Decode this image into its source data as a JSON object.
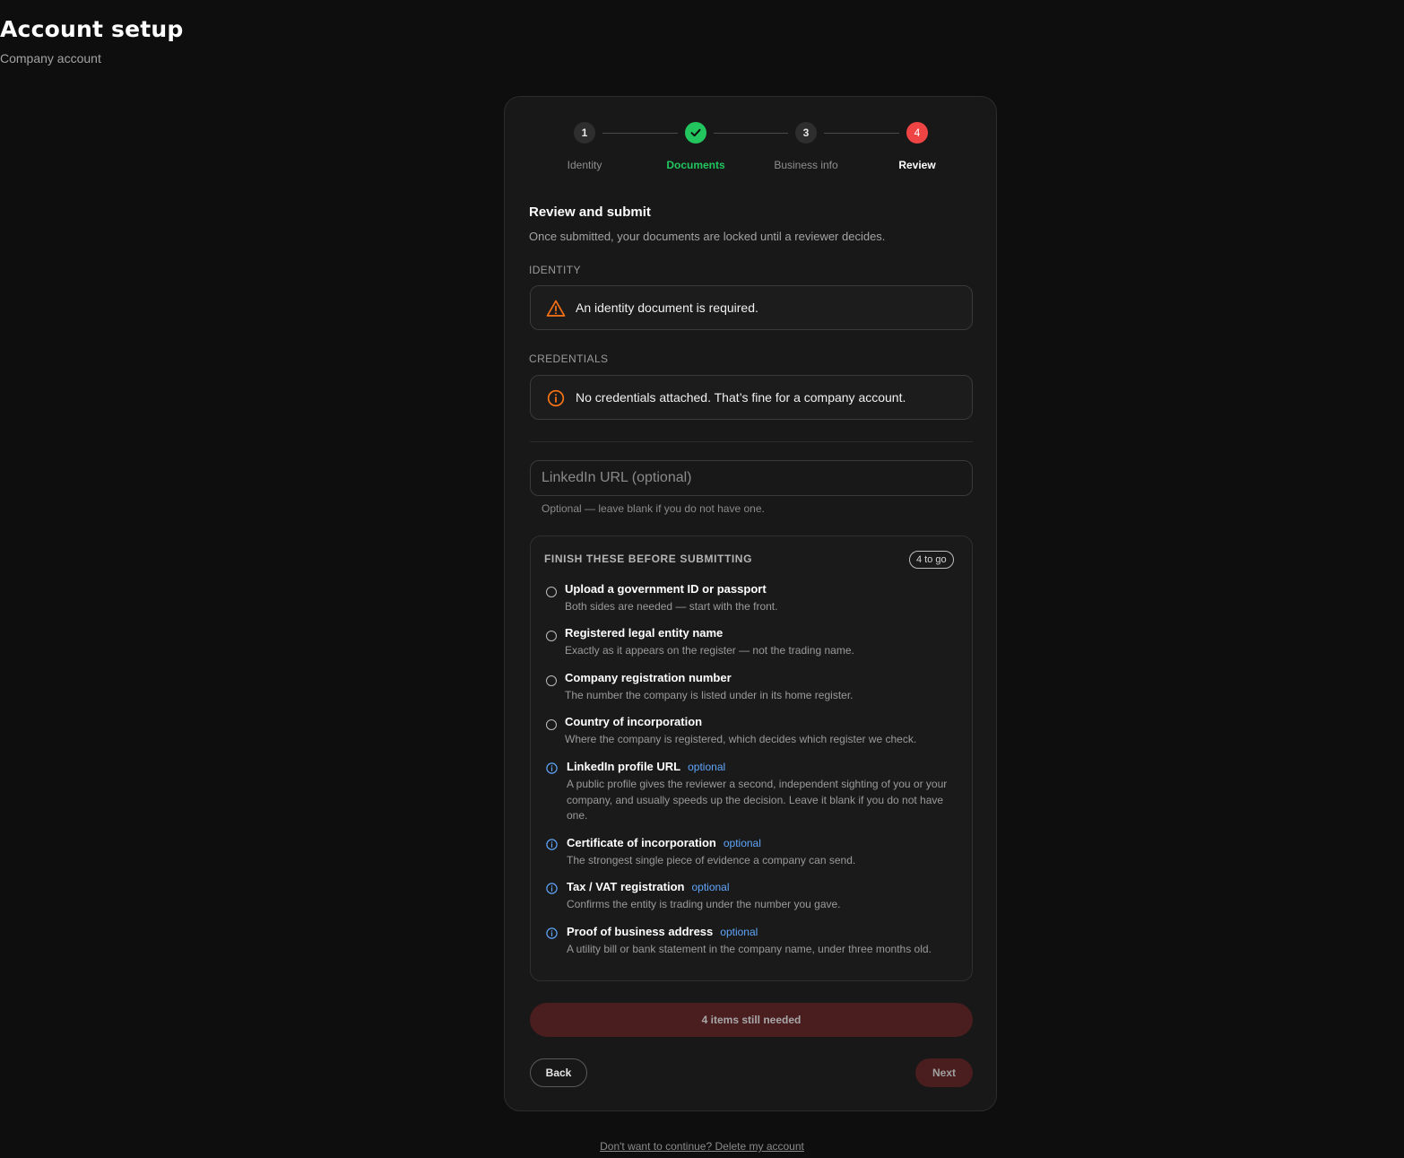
{
  "header": {
    "title": "Account setup",
    "subtitle": "Company account"
  },
  "stepper": {
    "steps": [
      {
        "number": "1",
        "label": "Identity",
        "state": "neutral"
      },
      {
        "number": "",
        "label": "Documents",
        "state": "done",
        "icon": "check-icon"
      },
      {
        "number": "3",
        "label": "Business info",
        "state": "neutral"
      },
      {
        "number": "4",
        "label": "Review",
        "state": "current"
      }
    ]
  },
  "review": {
    "title": "Review and submit",
    "description": "Once submitted, your documents are locked until a reviewer decides."
  },
  "identity": {
    "label": "IDENTITY",
    "notice": "An identity document is required.",
    "icon": "warning-triangle-icon"
  },
  "credentials": {
    "label": "CREDENTIALS",
    "notice": "No credentials attached. That’s fine for a company account.",
    "icon": "info-circle-icon"
  },
  "linkedin_field": {
    "value": "",
    "placeholder": "LinkedIn URL (optional)",
    "help": "Optional — leave blank if you do not have one."
  },
  "checklist": {
    "title": "FINISH THESE BEFORE SUBMITTING",
    "badge": "4 to go",
    "items": [
      {
        "title": "Upload a government ID or passport",
        "description": "Both sides are needed — start with the front.",
        "optional": ""
      },
      {
        "title": "Registered legal entity name",
        "description": "Exactly as it appears on the register — not the trading name.",
        "optional": ""
      },
      {
        "title": "Company registration number",
        "description": "The number the company is listed under in its home register.",
        "optional": ""
      },
      {
        "title": "Country of incorporation",
        "description": "Where the company is registered, which decides which register we check.",
        "optional": ""
      },
      {
        "title": "LinkedIn profile URL",
        "description": "A public profile gives the reviewer a second, independent sighting of you or your company, and usually speeds up the decision. Leave it blank if you do not have one.",
        "optional": "optional"
      },
      {
        "title": "Certificate of incorporation",
        "description": "The strongest single piece of evidence a company can send.",
        "optional": "optional"
      },
      {
        "title": "Tax / VAT registration",
        "description": "Confirms the entity is trading under the number you gave.",
        "optional": "optional"
      },
      {
        "title": "Proof of business address",
        "description": "A utility bill or bank statement in the company name, under three months old.",
        "optional": "optional"
      }
    ]
  },
  "status": {
    "label": "4 items still needed"
  },
  "nav": {
    "back_label": "Back",
    "next_label": "Next"
  },
  "footer": {
    "delete_link": "Don't want to continue? Delete my account"
  },
  "colors": {
    "background": "#0e0e0e",
    "card": "#181818",
    "success": "#22c55e",
    "danger": "#ef4444",
    "warning": "#f97316",
    "optional": "#60a5fa"
  }
}
